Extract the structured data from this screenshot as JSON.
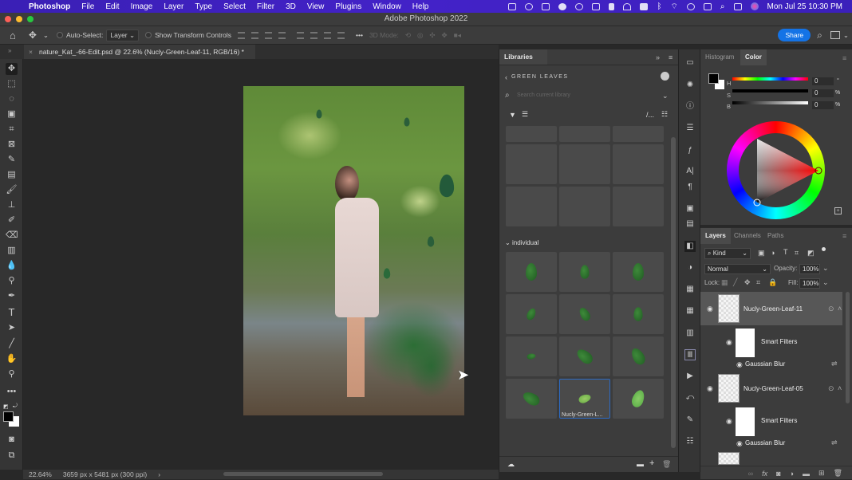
{
  "menubar": {
    "app": "Photoshop",
    "items": [
      "File",
      "Edit",
      "Image",
      "Layer",
      "Type",
      "Select",
      "Filter",
      "3D",
      "View",
      "Plugins",
      "Window",
      "Help"
    ],
    "clock": "Mon Jul 25  10:30 PM"
  },
  "window": {
    "title": "Adobe Photoshop 2022"
  },
  "options_bar": {
    "auto_select_label": "Auto-Select:",
    "auto_select_value": "Layer",
    "show_transform_label": "Show Transform Controls",
    "mode_3d_label": "3D Mode:",
    "more": "•••",
    "share_label": "Share"
  },
  "document": {
    "tab_title": "nature_Kat_-66-Edit.psd @ 22.6% (Nucly-Green-Leaf-11, RGB/16) *",
    "zoom": "22.64%",
    "dimensions": "3659 px x 5481 px (300 ppi)"
  },
  "libraries": {
    "tab": "Libraries",
    "library_name": "GREEN LEAVES",
    "search_placeholder": "Search current library",
    "section": "individual",
    "selected_item_label": "Nucly-Green-L..."
  },
  "color_panel": {
    "tabs": [
      "Histogram",
      "Color"
    ],
    "active_tab": "Color",
    "h": {
      "label": "H",
      "value": "0",
      "unit": "°"
    },
    "s": {
      "label": "S",
      "value": "0",
      "unit": "%"
    },
    "b": {
      "label": "B",
      "value": "0",
      "unit": "%"
    },
    "foreground": "#000000",
    "background": "#ffffff"
  },
  "layers_panel": {
    "tabs": [
      "Layers",
      "Channels",
      "Paths"
    ],
    "active_tab": "Layers",
    "filter_kind": "Kind",
    "blend_mode": "Normal",
    "opacity_label": "Opacity:",
    "opacity": "100%",
    "lock_label": "Lock:",
    "fill_label": "Fill:",
    "fill": "100%",
    "layers": [
      {
        "name": "Nucly-Green-Leaf-11",
        "selected": true,
        "smart_filters": "Smart Filters",
        "filter": "Gaussian Blur"
      },
      {
        "name": "Nucly-Green-Leaf-05",
        "selected": false,
        "smart_filters": "Smart Filters",
        "filter": "Gaussian Blur"
      }
    ]
  },
  "colors": {
    "accent": "#1473e6",
    "menubar": "#4322c8"
  }
}
